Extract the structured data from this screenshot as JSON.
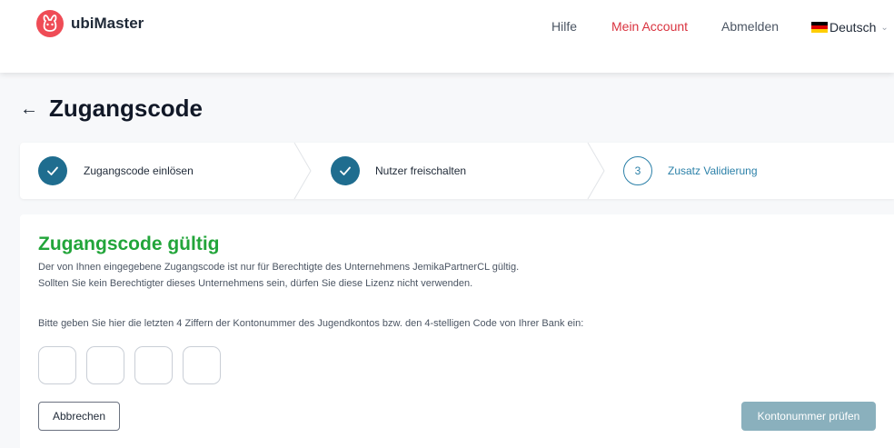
{
  "header": {
    "brand": "ubiMaster",
    "nav": [
      {
        "label": "Hilfe"
      },
      {
        "label": "Mein Account"
      },
      {
        "label": "Abmelden"
      }
    ],
    "language": "Deutsch",
    "accent_color": "#d9333f"
  },
  "page": {
    "title": "Zugangscode"
  },
  "steps": [
    {
      "label": "Zugangscode einlösen",
      "state": "done"
    },
    {
      "label": "Nutzer freischalten",
      "state": "done"
    },
    {
      "label": "Zusatz Validierung",
      "state": "current",
      "number": "3"
    }
  ],
  "card": {
    "title": "Zugangscode gültig",
    "info_line1": "Der von Ihnen eingegebene Zugangscode ist nur für Berechtigte des Unternehmens JemikaPartnerCL gültig.",
    "info_line2": "Sollten Sie kein Berechtigter dieses Unternehmens sein, dürfen Sie diese Lizenz nicht verwenden.",
    "prompt": "Bitte geben Sie hier die letzten 4 Ziffern der Kontonummer des Jugendkontos bzw. den 4-stelligen Code von Ihrer Bank ein:",
    "code_values": [
      "",
      "",
      "",
      ""
    ],
    "cancel_label": "Abbrechen",
    "submit_label": "Kontonummer prüfen"
  },
  "colors": {
    "success": "#22a53a",
    "step_done": "#1f6d8f",
    "step_current": "#2b80a8",
    "submit_disabled": "#8ab0bd"
  }
}
